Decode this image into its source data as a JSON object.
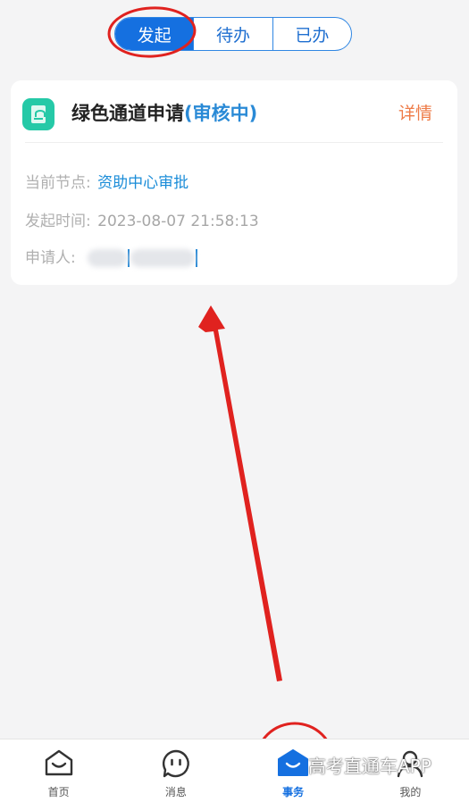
{
  "tabs": [
    {
      "label": "发起",
      "active": true
    },
    {
      "label": "待办",
      "active": false
    },
    {
      "label": "已办",
      "active": false
    }
  ],
  "card": {
    "icon": "document-icon",
    "title": "绿色通道申请",
    "status": "(审核中)",
    "detail_label": "详情",
    "node_label": "当前节点:",
    "node_value": "资助中心审批",
    "time_label": "发起时间:",
    "time_value": "2023-08-07 21:58:13",
    "applicant_label": "申请人:"
  },
  "nav": [
    {
      "label": "首页",
      "icon": "home-icon"
    },
    {
      "label": "消息",
      "icon": "message-icon"
    },
    {
      "label": "事务",
      "icon": "affairs-icon",
      "active": true
    },
    {
      "label": "我的",
      "icon": "profile-icon"
    }
  ],
  "watermark": "高考直通车APP",
  "colors": {
    "primary": "#1570e0",
    "status": "#2a8ad6",
    "detail": "#ee7b47",
    "annotation": "#e0221f"
  }
}
